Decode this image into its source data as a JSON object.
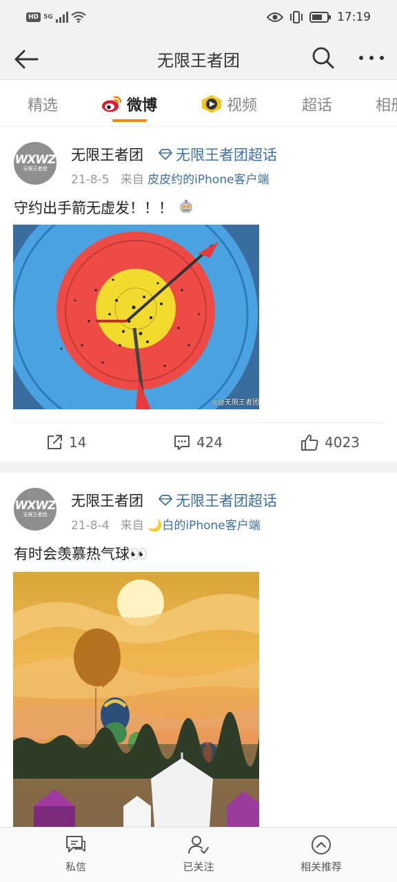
{
  "status_bar": {
    "left_badges": [
      "HD",
      "5G"
    ],
    "time": "17:19"
  },
  "header": {
    "title": "无限王者团",
    "back_icon": "arrow-left-icon",
    "search_icon": "search-icon",
    "more_icon": "more-dots-icon"
  },
  "tabs": [
    {
      "label": "精选"
    },
    {
      "label": "微博",
      "active": true,
      "icon": "weibo-logo-icon"
    },
    {
      "label": "视频",
      "icon": "video-play-icon"
    },
    {
      "label": "超话"
    },
    {
      "label": "相册"
    }
  ],
  "accent_color": "#ff8200",
  "link_color": "#3b6fa6",
  "posts": [
    {
      "avatar_text": "WXWZ",
      "avatar_subtext": "无限王者团",
      "author": "无限王者团",
      "chaohua": "无限王者团超话",
      "date": "21-8-5",
      "from_label": "来自",
      "source": "皮皮约的iPhone客户端",
      "text": "守约出手箭无虚发！！！",
      "emoji_icon": "robot-emoji-icon",
      "image_desc_icon": "archery-target-image",
      "watermark": "◎@无限王者团",
      "reposts": "14",
      "comments": "424",
      "likes": "4023"
    },
    {
      "avatar_text": "WXWZ",
      "avatar_subtext": "无限王者团",
      "author": "无限王者团",
      "chaohua": "无限王者团超话",
      "date": "21-8-4",
      "from_label": "来自",
      "source": "🌙白的iPhone客户端",
      "text": "有时会羡慕热气球👀",
      "image_desc_icon": "hot-air-balloons-image"
    }
  ],
  "bottom_bar": [
    {
      "label": "私信",
      "icon": "message-icon"
    },
    {
      "label": "已关注",
      "icon": "followed-user-icon"
    },
    {
      "label": "相关推荐",
      "icon": "chevron-up-circle-icon"
    }
  ]
}
